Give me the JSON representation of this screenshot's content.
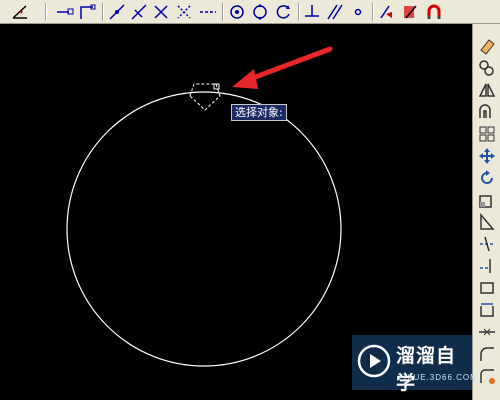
{
  "app": {
    "name": "CAD drawing area"
  },
  "canvas": {
    "background": "#000000",
    "circle_color": "#ffffff",
    "arrow_color": "#e8262b"
  },
  "tooltip": {
    "text": "选择对象:"
  },
  "watermark": {
    "title": "溜溜自学",
    "url": "ZIXUE.3D66.COM"
  },
  "toolbar_icons": [
    "dimension-icon",
    "ray-icon",
    "line-icon",
    "polyline-icon",
    "construction-line-icon",
    "cross-icon",
    "cross-intersect-icon",
    "dash-line-icon",
    "center-icon",
    "quadrant-icon",
    "tangent-icon",
    "perpendicular-icon",
    "parallel-icon",
    "node-icon",
    "snap-settings-icon",
    "clear-snap-icon",
    "magnet-icon"
  ],
  "sidebar_icons": [
    "erase-icon",
    "copy-icon",
    "mirror-icon",
    "offset-icon",
    "array-icon",
    "move-icon",
    "rotate-icon",
    "scale-icon",
    "stretch-icon",
    "trim-icon",
    "extend-icon",
    "break-icon",
    "join-icon",
    "chamfer-icon",
    "fillet-icon",
    "explode-icon"
  ]
}
